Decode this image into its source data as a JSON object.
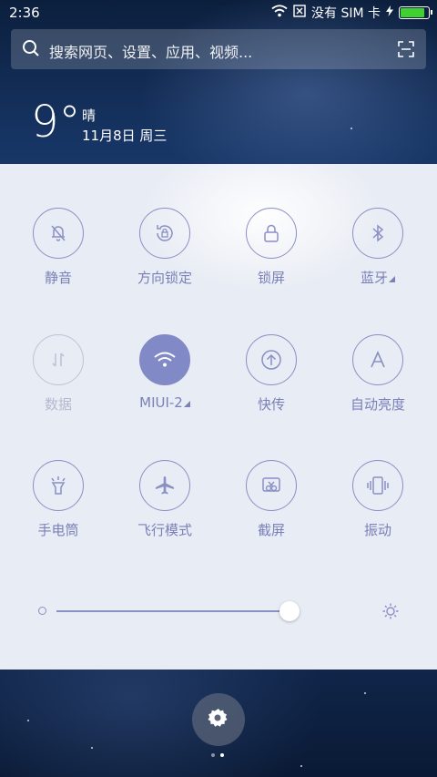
{
  "status_bar": {
    "time": "2:36",
    "sim_text": "没有 SIM 卡",
    "battery_color": "#3ed12f"
  },
  "search": {
    "placeholder": "搜索网页、设置、应用、视频..."
  },
  "weather": {
    "temperature": "9°",
    "condition": "晴",
    "date": "11月8日 周三"
  },
  "toggles": [
    {
      "label": "静音",
      "icon": "mute-bell-icon",
      "state": "off"
    },
    {
      "label": "方向锁定",
      "icon": "rotation-lock-icon",
      "state": "off"
    },
    {
      "label": "锁屏",
      "icon": "lock-icon",
      "state": "off"
    },
    {
      "label": "蓝牙",
      "icon": "bluetooth-icon",
      "state": "off"
    },
    {
      "label": "数据",
      "icon": "mobile-data-icon",
      "state": "disabled"
    },
    {
      "label": "MIUI-2",
      "icon": "wifi-icon",
      "state": "on"
    },
    {
      "label": "快传",
      "icon": "quick-transfer-icon",
      "state": "off"
    },
    {
      "label": "自动亮度",
      "icon": "auto-brightness-icon",
      "state": "off"
    },
    {
      "label": "手电筒",
      "icon": "flashlight-icon",
      "state": "off"
    },
    {
      "label": "飞行模式",
      "icon": "airplane-icon",
      "state": "off"
    },
    {
      "label": "截屏",
      "icon": "screenshot-icon",
      "state": "off"
    },
    {
      "label": "振动",
      "icon": "vibrate-icon",
      "state": "off"
    }
  ],
  "brightness": {
    "level": 0.96
  },
  "accent_color": "#8189c7",
  "page_indicator": {
    "pages": 2,
    "current": 2
  }
}
